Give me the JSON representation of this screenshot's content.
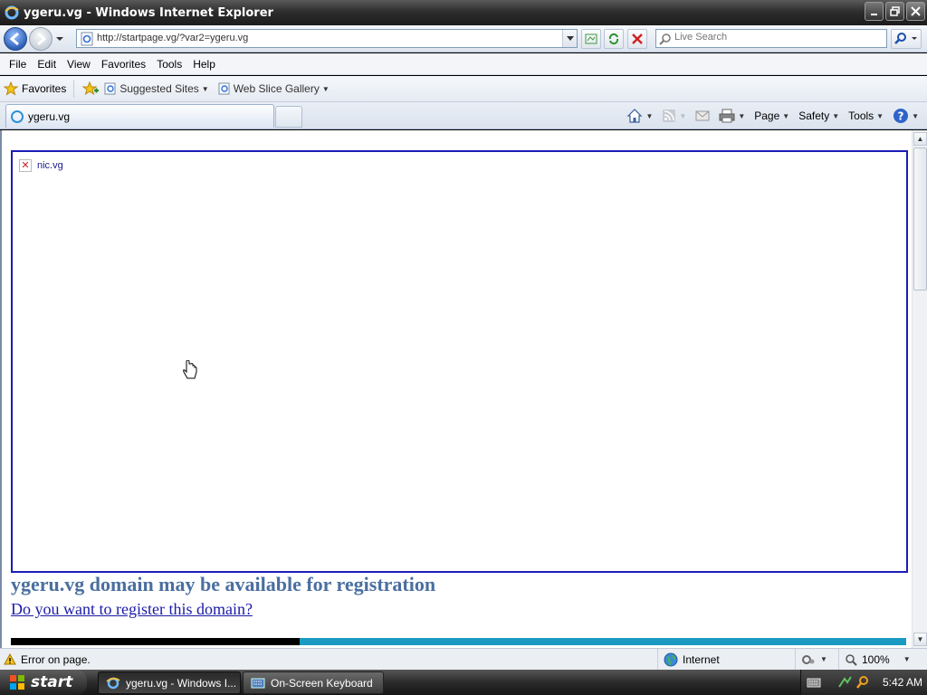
{
  "window": {
    "title": "ygeru.vg - Windows Internet Explorer"
  },
  "address": {
    "url": "http://startpage.vg/?var2=ygeru.vg"
  },
  "search": {
    "placeholder": "Live Search"
  },
  "menu": {
    "items": [
      "File",
      "Edit",
      "View",
      "Favorites",
      "Tools",
      "Help"
    ]
  },
  "favorites": {
    "label": "Favorites",
    "links": [
      "Suggested Sites",
      "Web Slice Gallery"
    ]
  },
  "tab": {
    "title": "ygeru.vg"
  },
  "commands": {
    "page": "Page",
    "safety": "Safety",
    "tools": "Tools"
  },
  "content": {
    "broken_image_alt": "nic.vg",
    "heading": "ygeru.vg domain may be available for registration",
    "link": "Do you want to register this domain?"
  },
  "status": {
    "text": "Error on page.",
    "zone": "Internet",
    "zoom": "100%"
  },
  "taskbar": {
    "start": "start",
    "items": [
      "ygeru.vg - Windows I...",
      "On-Screen Keyboard"
    ],
    "clock": "5:42 AM"
  }
}
